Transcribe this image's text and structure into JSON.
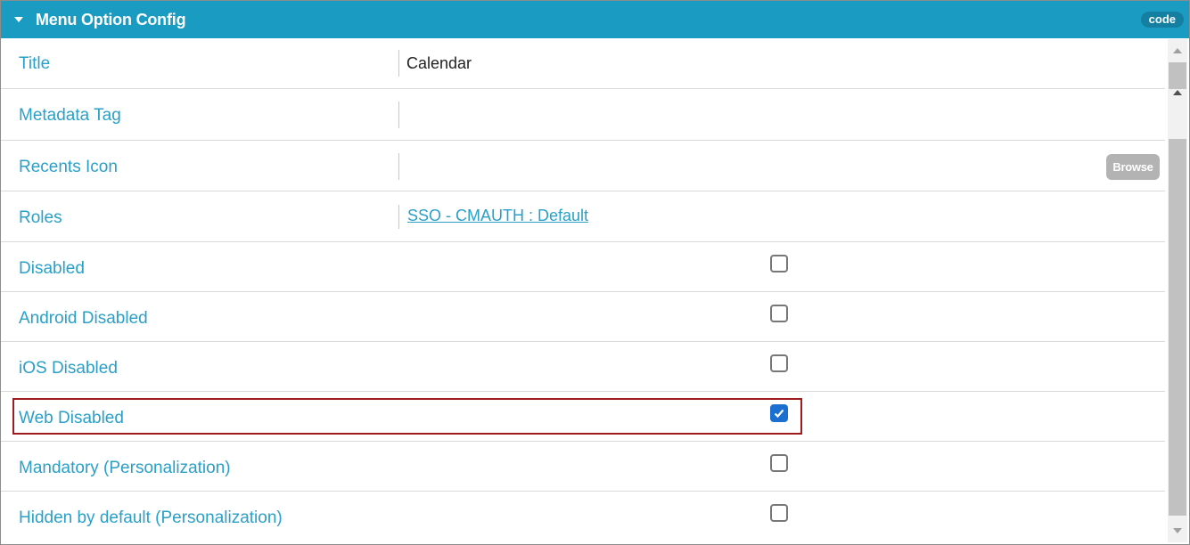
{
  "header": {
    "title": "Menu Option Config",
    "badge": "code"
  },
  "fields": {
    "title": {
      "label": "Title",
      "value": "Calendar"
    },
    "metadata_tag": {
      "label": "Metadata Tag",
      "value": ""
    },
    "recents_icon": {
      "label": "Recents Icon",
      "button": "Browse"
    },
    "roles": {
      "label": "Roles",
      "link": "SSO - CMAUTH : Default"
    },
    "disabled": {
      "label": "Disabled",
      "checked": false
    },
    "android_disabled": {
      "label": "Android Disabled",
      "checked": false
    },
    "ios_disabled": {
      "label": "iOS Disabled",
      "checked": false
    },
    "web_disabled": {
      "label": "Web Disabled",
      "checked": true
    },
    "mandatory": {
      "label": "Mandatory (Personalization)",
      "checked": false
    },
    "hidden_by_default": {
      "label": "Hidden by default (Personalization)",
      "checked": false
    }
  },
  "colors": {
    "header_bg": "#1a9bc2",
    "label": "#2aa0c8",
    "checkbox_checked": "#1a6fd1",
    "highlight_border": "#a01c1c"
  }
}
